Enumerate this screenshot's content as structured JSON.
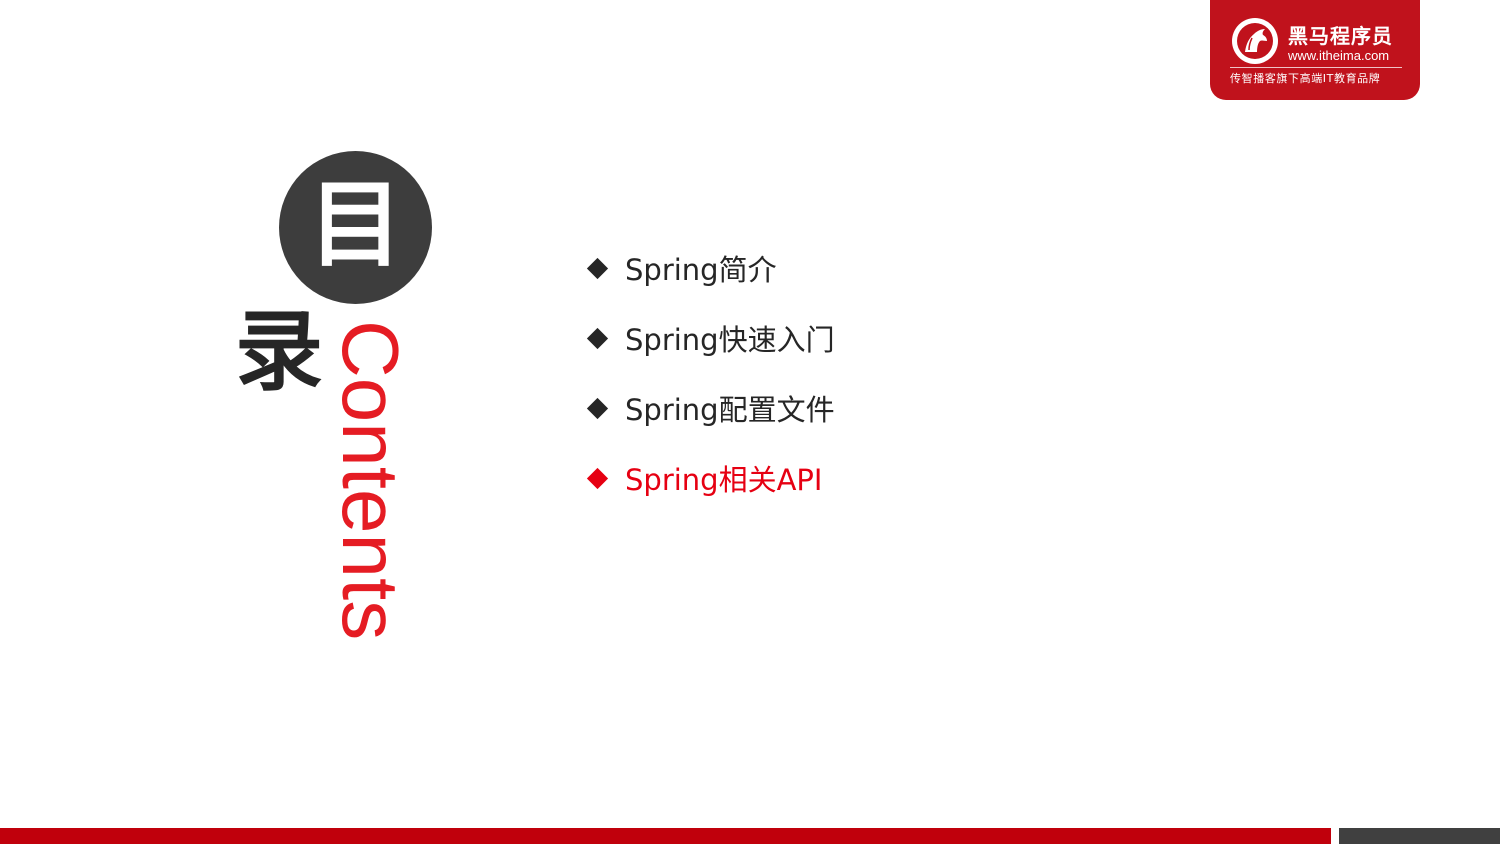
{
  "brand": {
    "name": "黑马程序员",
    "url": "www.itheima.com",
    "slogan": "传智播客旗下高端IT教育品牌",
    "logo_icon": "horse-head-icon",
    "color": "#c0121c"
  },
  "title": {
    "char_1": "目",
    "char_2": "录",
    "english": "Contents",
    "circle_color": "#3d3d3d",
    "english_color": "#e51c23"
  },
  "menu": {
    "items": [
      {
        "label": "Spring简介",
        "active": false
      },
      {
        "label": "Spring快速入门",
        "active": false
      },
      {
        "label": "Spring配置文件",
        "active": false
      },
      {
        "label": "Spring相关API",
        "active": true
      }
    ],
    "text_color": "#262626",
    "active_color": "#e60012"
  },
  "footer": {
    "bar_color": "#c0000c",
    "accent_color": "#404040"
  }
}
